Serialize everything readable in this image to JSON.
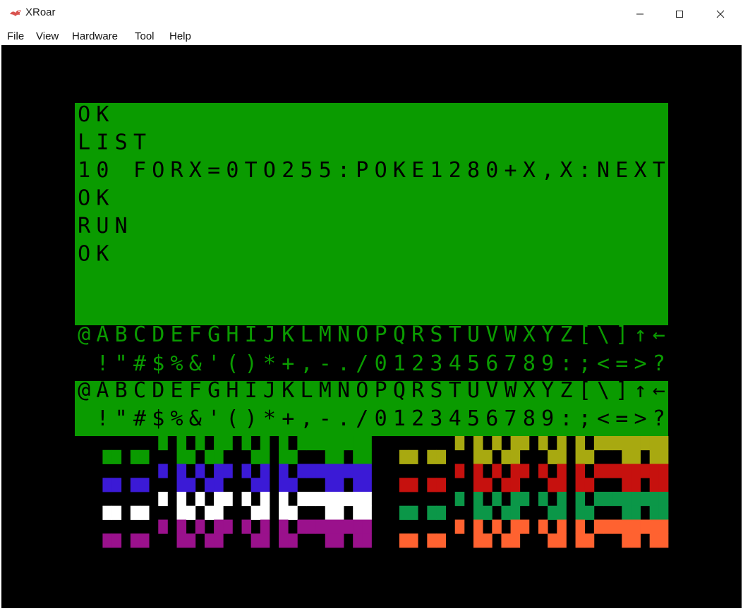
{
  "window": {
    "title": "XRoar",
    "icon": "xroar-dragon-icon"
  },
  "menu": [
    "File",
    "View",
    "Hardware",
    "Tool",
    "Help"
  ],
  "emulator": {
    "text_lines": [
      "OK",
      "LIST",
      "10 FORX=0TO255:POKE1280+X,X:NEXT",
      "OK",
      "RUN",
      "OK"
    ],
    "charset_row1": "@ABCDEFGHIJKLMNOPQRSTUVWXYZ[\\]↑←",
    "charset_row2": " !\"#$%&'()*+,-./0123456789:;<=>?",
    "colors": {
      "screen_green": "#0a9b00",
      "inverse_text": "#0a9b00",
      "border": "#000000",
      "semigraphics": [
        "#0a9b00",
        "#3b1ad6",
        "#ffffff",
        "#9a118c",
        "#a8a910",
        "#c6110e",
        "#0b9748",
        "#ff6230"
      ]
    }
  }
}
